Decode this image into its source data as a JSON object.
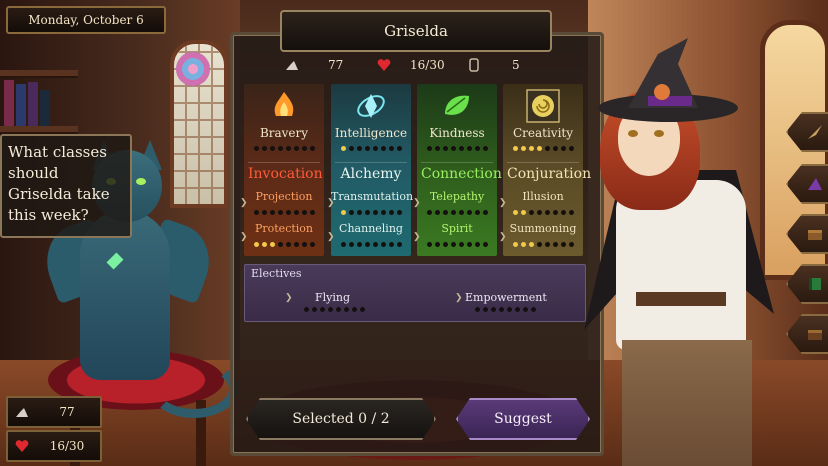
{
  "date": "Monday, October 6",
  "dialogue": "What classes should Griselda take this week?",
  "character_name": "Griselda",
  "resources": {
    "magic": "77",
    "health": "16/30",
    "scroll": "5"
  },
  "bottom_stats": {
    "magic": "77",
    "health": "16/30"
  },
  "stats": [
    {
      "name": "Bravery",
      "icon": "fire-icon",
      "level": 0,
      "color": "#ff5a3a",
      "school": "Invocation",
      "classes": [
        {
          "name": "Projection",
          "level": 0
        },
        {
          "name": "Protection",
          "level": 3
        }
      ]
    },
    {
      "name": "Intelligence",
      "icon": "crystal-icon",
      "level": 1,
      "color": "#e8f4f0",
      "school": "Alchemy",
      "classes": [
        {
          "name": "Transmutation",
          "level": 1
        },
        {
          "name": "Channeling",
          "level": 0
        }
      ]
    },
    {
      "name": "Kindness",
      "icon": "leaf-icon",
      "level": 0,
      "color": "#9af060",
      "school": "Connection",
      "classes": [
        {
          "name": "Telepathy",
          "level": 0
        },
        {
          "name": "Spirit",
          "level": 0
        }
      ]
    },
    {
      "name": "Creativity",
      "icon": "spiral-icon",
      "level": 4,
      "color": "#f4e4b4",
      "school": "Conjuration",
      "classes": [
        {
          "name": "Illusion",
          "level": 2
        },
        {
          "name": "Summoning",
          "level": 3
        }
      ]
    }
  ],
  "electives": {
    "title": "Electives",
    "items": [
      {
        "name": "Flying",
        "level": 0
      },
      {
        "name": "Empowerment",
        "level": 0
      }
    ]
  },
  "selection": {
    "label": "Selected 0 / 2"
  },
  "suggest_label": "Suggest",
  "colors": {
    "panel": "#221a16",
    "gold_pip": "#f2c94a",
    "suggest": "#5a3a78"
  }
}
